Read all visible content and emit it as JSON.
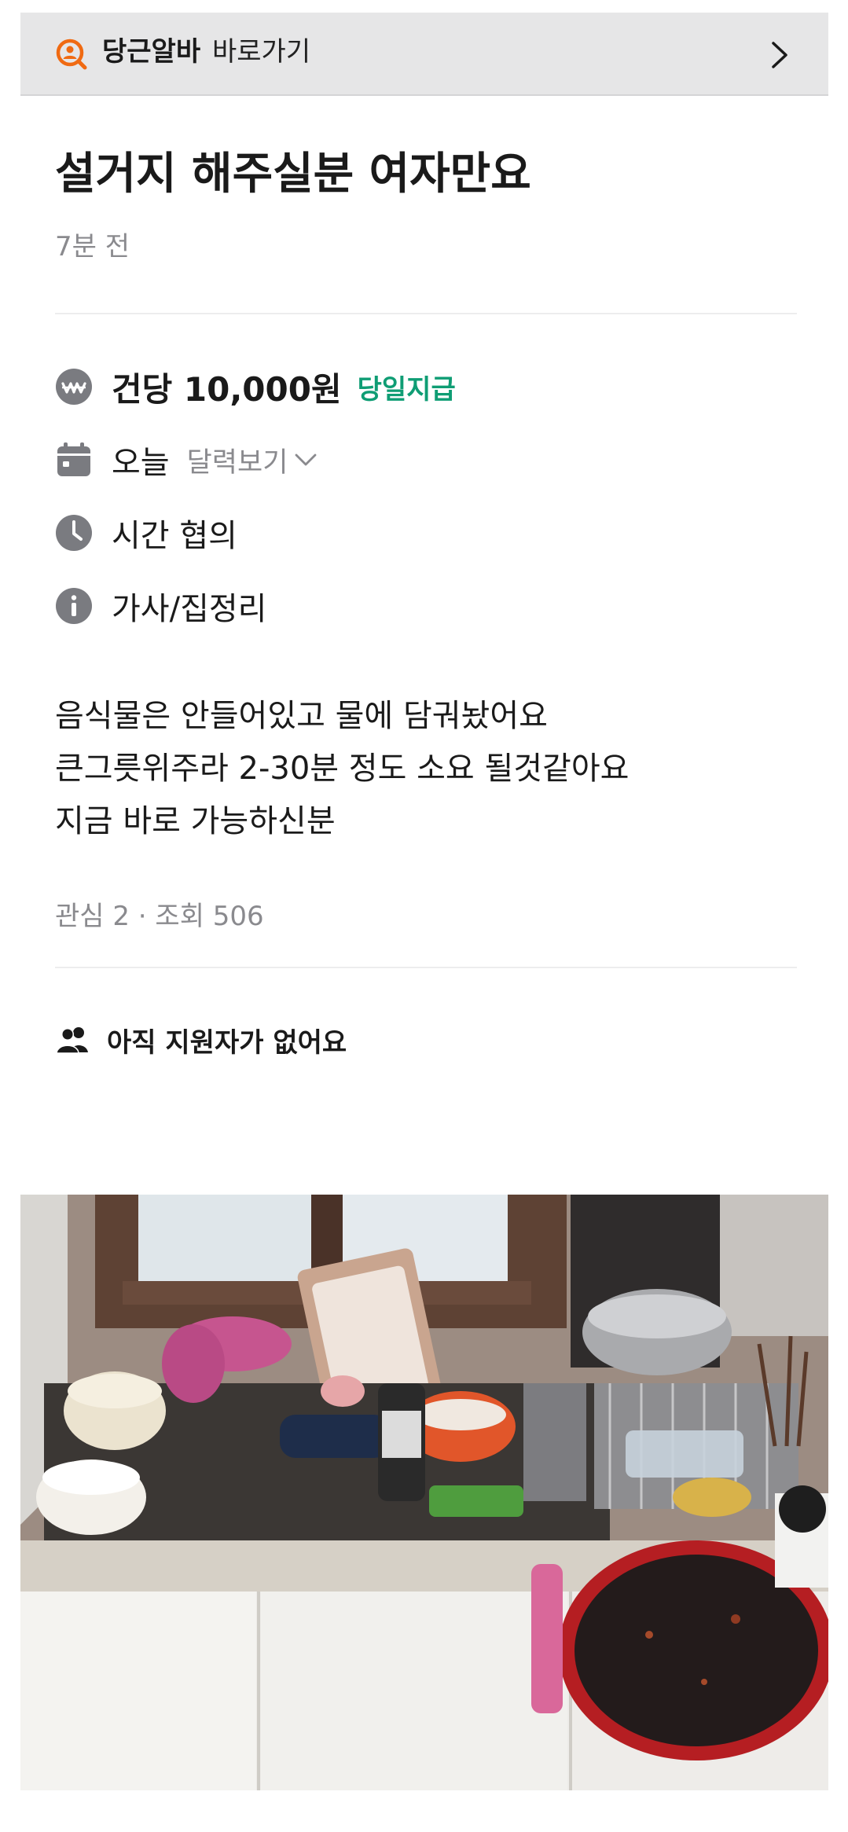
{
  "banner": {
    "brand": "당근알바",
    "link_text": "바로가기",
    "icon": "magnifier-person-icon",
    "chevron_icon": "chevron-right-icon"
  },
  "post": {
    "title": "설거지 해주실분 여자만요",
    "time_ago": "7분 전"
  },
  "details": {
    "pay": "건당 10,000원",
    "pay_tag": "당일지급",
    "date": "오늘",
    "calendar_link": "달력보기",
    "time": "시간 협의",
    "category": "가사/집정리"
  },
  "description": [
    "음식물은 안들어있고 물에 담궈놨어요",
    "큰그릇위주라 2-30분 정도 소요 될것같아요",
    "지금 바로 가능하신분"
  ],
  "stats": "관심 2 · 조회 506",
  "applicants": "아직 지원자가 없어요",
  "colors": {
    "brand_orange": "#f06a12",
    "pay_green": "#0f9d74",
    "icon_gray": "#7a7b80",
    "muted_text": "#8a8a8e",
    "banner_bg": "#e6e6e7"
  }
}
